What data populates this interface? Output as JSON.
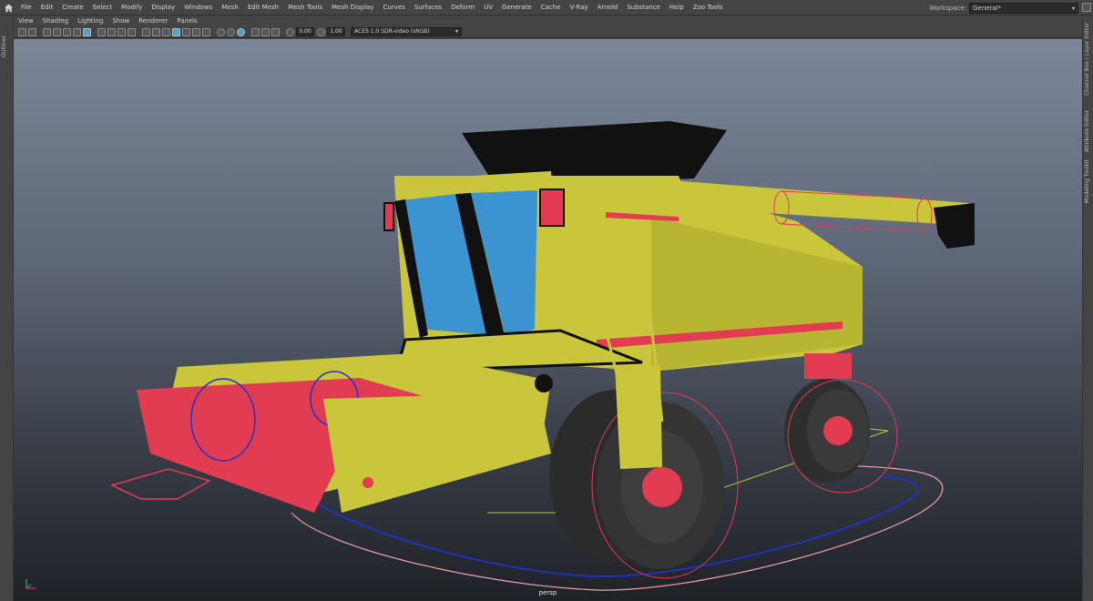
{
  "app": {
    "main_menu": [
      "File",
      "Edit",
      "Create",
      "Select",
      "Modify",
      "Display",
      "Windows",
      "Mesh",
      "Edit Mesh",
      "Mesh Tools",
      "Mesh Display",
      "Curves",
      "Surfaces",
      "Deform",
      "UV",
      "Generate",
      "Cache",
      "V-Ray",
      "Arnold",
      "Substance",
      "Help",
      "Zoo Tools"
    ],
    "workspace_label": "Workspace:",
    "workspace_value": "General*"
  },
  "left_strip": {
    "label": "Outliner"
  },
  "right_strip": {
    "tabs": [
      "Channel Box / Layer Editor",
      "Attribute Editor",
      "Modeling Toolkit"
    ]
  },
  "panel": {
    "menu": [
      "View",
      "Shading",
      "Lighting",
      "Show",
      "Renderer",
      "Panels"
    ],
    "toolbar": {
      "exposure": "0.00",
      "gamma": "1.00",
      "color_space": "ACES 1.0 SDR-video (sRGB)"
    },
    "camera_label": "persp"
  },
  "icons": [
    "home-icon",
    "camera-icon",
    "grid-icon",
    "wireframe-icon",
    "smooth-shade-icon",
    "textured-icon",
    "lights-icon",
    "shadows-icon",
    "isolate-icon",
    "xray-icon",
    "exposure-icon",
    "gamma-icon",
    "dropdown-icon"
  ],
  "colors": {
    "body_yellow": "#c9c63c",
    "accent_red": "#e23c52",
    "glass_blue": "#3b93d0",
    "tire_dark": "#2e2e2e",
    "selection_blue": "#2233c8",
    "curve_pink": "#e79aa6"
  }
}
